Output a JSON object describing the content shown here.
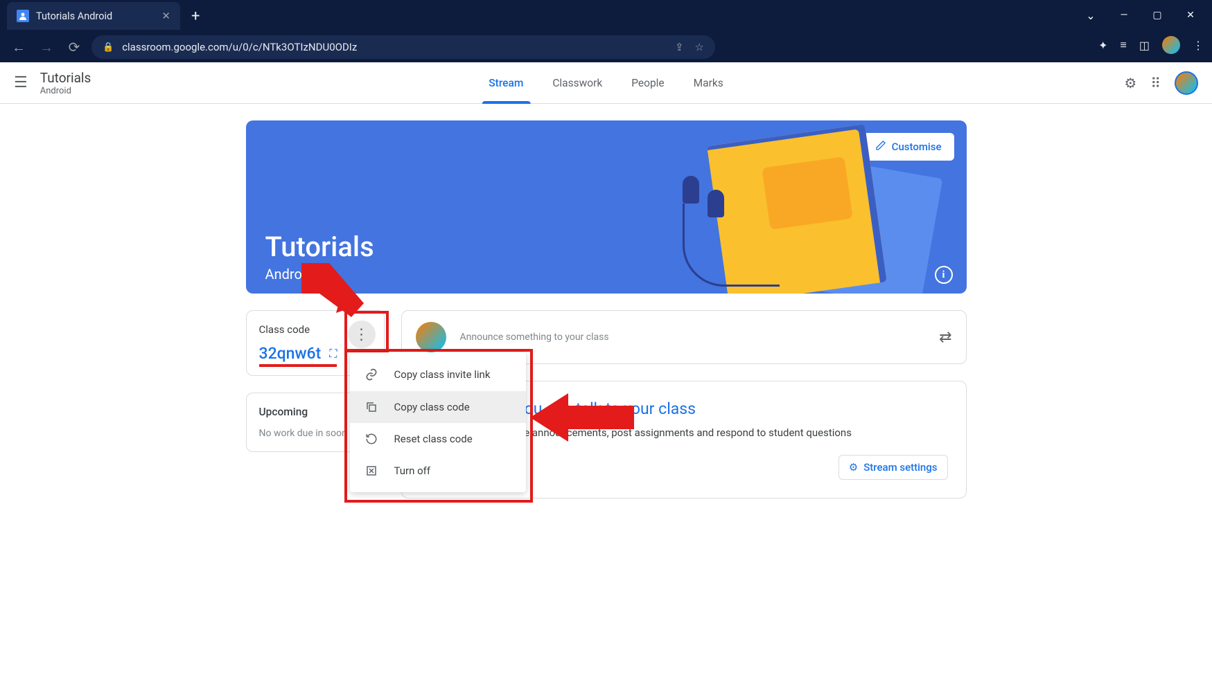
{
  "browser": {
    "tab_title": "Tutorials Android",
    "url": "classroom.google.com/u/0/c/NTk3OTIzNDU0ODIz"
  },
  "header": {
    "class_name": "Tutorials",
    "class_section": "Android",
    "tabs": [
      "Stream",
      "Classwork",
      "People",
      "Marks"
    ]
  },
  "banner": {
    "title": "Tutorials",
    "subtitle": "Android",
    "customise": "Customise"
  },
  "code_card": {
    "label": "Class code",
    "code": "32qnw6t"
  },
  "upcoming": {
    "title": "Upcoming",
    "text": "No work due in soon"
  },
  "announce": {
    "placeholder": "Announce something to your class"
  },
  "stream_msg": {
    "heading": "This is where you can talk to your class",
    "body": "Use the stream to share announcements, post assignments and respond to student questions",
    "settings_btn": "Stream settings"
  },
  "dropdown": {
    "items": [
      {
        "icon": "link",
        "label": "Copy class invite link"
      },
      {
        "icon": "copy",
        "label": "Copy class code"
      },
      {
        "icon": "reset",
        "label": "Reset class code"
      },
      {
        "icon": "off",
        "label": "Turn off"
      }
    ]
  }
}
